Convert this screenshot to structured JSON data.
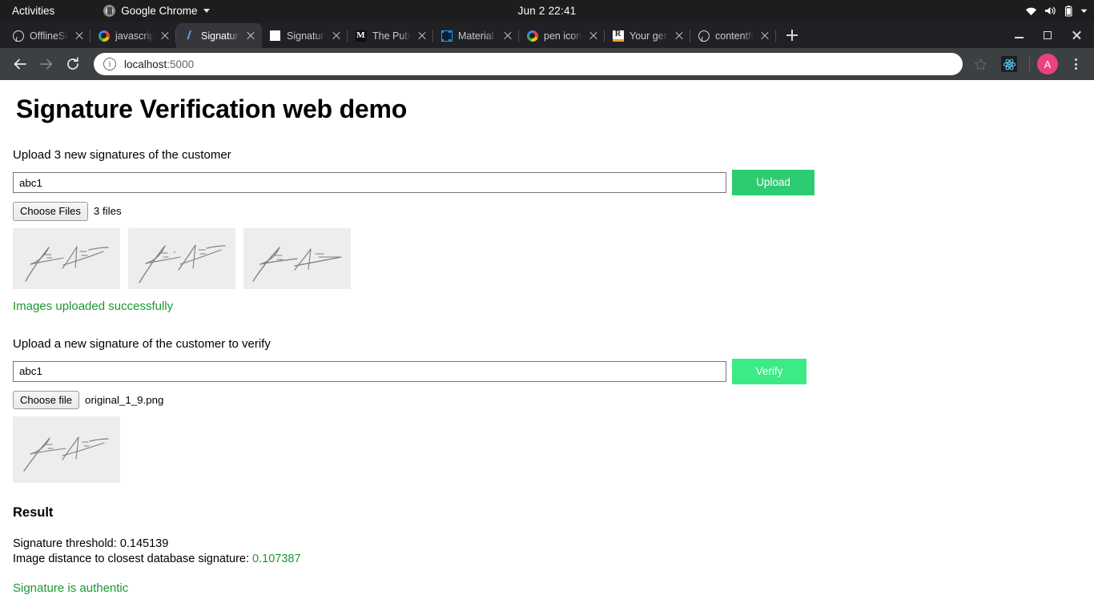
{
  "desktop": {
    "activities": "Activities",
    "app_name": "Google Chrome",
    "clock": "Jun 2  22:41",
    "status_icons": [
      "wifi-icon",
      "volume-icon",
      "battery-icon",
      "chevron-down-icon"
    ]
  },
  "browser": {
    "tabs": [
      {
        "title": "OfflineSig",
        "favicon": "github-icon",
        "active": false
      },
      {
        "title": "javascript",
        "favicon": "google-icon",
        "active": false
      },
      {
        "title": "Signature",
        "favicon": "slash-icon",
        "active": true
      },
      {
        "title": "Signature",
        "favicon": "white-square-icon",
        "active": false
      },
      {
        "title": "The Public",
        "favicon": "medium-icon",
        "active": false
      },
      {
        "title": "Material D",
        "favicon": "material-design-icon",
        "active": false
      },
      {
        "title": "pen icon s",
        "favicon": "google-icon",
        "active": false
      },
      {
        "title": "Your gene",
        "favicon": "r-brand-icon",
        "active": false
      },
      {
        "title": "contentfu",
        "favicon": "github-icon",
        "active": false
      }
    ],
    "new_tab_label": "+",
    "window_controls": [
      "minimize-icon",
      "maximize-icon",
      "close-icon"
    ],
    "nav": {
      "back": "back-arrow-icon",
      "forward": "forward-arrow-icon",
      "reload": "reload-icon"
    },
    "omnibox": {
      "info_icon": "info-circle-icon",
      "url_host": "localhost",
      "url_port": ":5000",
      "bookmark_icon": "star-icon"
    },
    "extension_icon": "react-devtools-icon",
    "profile_initial": "A",
    "menu_icon": "kebab-menu-icon"
  },
  "page": {
    "title": "Signature Verification web demo",
    "upload_section": {
      "label": "Upload 3 new signatures of the customer",
      "input_value": "abc1",
      "input_placeholder": "",
      "button_label": "Upload",
      "file_button_label": "Choose Files",
      "file_status": "3 files",
      "thumbnail_count": 3,
      "success_message": "Images uploaded successfully"
    },
    "verify_section": {
      "label": "Upload a new signature of the customer to verify",
      "input_value": "abc1",
      "input_placeholder": "",
      "button_label": "Verify",
      "file_button_label": "Choose file",
      "file_name": "original_1_9.png"
    },
    "result": {
      "heading": "Result",
      "threshold_label": "Signature threshold: ",
      "threshold_value": "0.145139",
      "distance_label": "Image distance to closest database signature: ",
      "distance_value": "0.107387",
      "verdict": "Signature is authentic"
    }
  },
  "colors": {
    "upload_button": "#2ecc71",
    "verify_button": "#3ceb83",
    "success_text": "#1a9830",
    "avatar": "#e8437f"
  }
}
